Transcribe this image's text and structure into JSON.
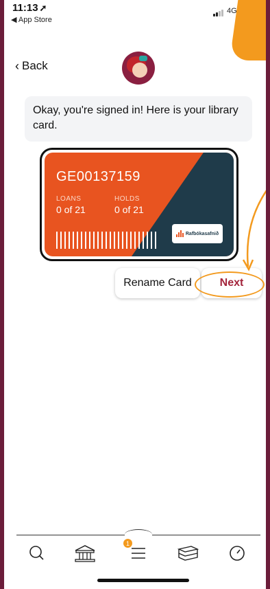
{
  "status_bar": {
    "time": "11:13",
    "back_app": "◀ App Store",
    "network": "4G"
  },
  "nav": {
    "back_label": "Back"
  },
  "message": {
    "text": "Okay, you're signed in! Here is your library card."
  },
  "card": {
    "number": "GE00137159",
    "loans_label": "LOANS",
    "loans_value": "0 of 21",
    "holds_label": "HOLDS",
    "holds_value": "0 of 21",
    "library_name": "Rafbókasafnið"
  },
  "actions": {
    "rename_label": "Rename Card",
    "next_label": "Next"
  },
  "tabbar": {
    "items": [
      "search-icon",
      "library-icon",
      "menu-icon",
      "shelf-icon",
      "clock-icon"
    ],
    "badge_count": "1"
  },
  "colors": {
    "accent": "#a3243b",
    "card_orange": "#e85420",
    "card_dark": "#1f3b4a",
    "annotation": "#f39a1e",
    "background_frame": "#6b1d3a"
  }
}
